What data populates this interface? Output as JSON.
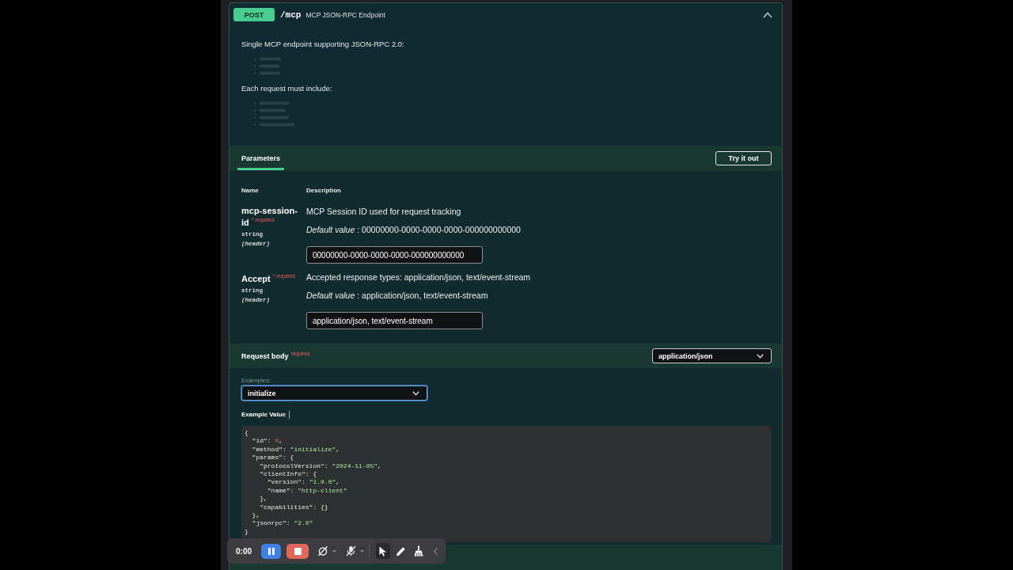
{
  "operation": {
    "method": "POST",
    "path": "/mcp",
    "summary": "MCP JSON-RPC Endpoint",
    "expanded": true
  },
  "description": [
    {
      "kind": "paragraph",
      "text": "Single MCP endpoint supporting JSON-RPC 2.0:"
    },
    {
      "kind": "faded_list"
    },
    {
      "kind": "paragraph",
      "text": "Each request must include:"
    },
    {
      "kind": "faded_list"
    }
  ],
  "parameters": {
    "tabs": [
      {
        "label": "Parameters",
        "selected": true
      }
    ],
    "try_button": "Try it out",
    "columns": [
      "Name",
      "Description"
    ],
    "rows": [
      {
        "name": "mcp-session-id",
        "required_label": "* required",
        "type": "string",
        "location": "(header)",
        "description": "MCP Session ID used for request tracking",
        "default": "*Default value* : 00000000-0000-0000-0000-000000000000",
        "value": "00000000-0000-0000-0000-000000000000"
      },
      {
        "name": "Accept",
        "required_label": "* required",
        "type": "string",
        "location": "(header)",
        "description": "Accepted response types: application/json, text/event-stream",
        "default": "*Default value* : application/json, text/event-stream",
        "value": "application/json, text/event-stream"
      }
    ]
  },
  "request_body": {
    "title": "Request body",
    "required_label": "required",
    "content_type": "application/json",
    "examples_label": "Examples:",
    "example": {
      "value": "initialize",
      "focused": true
    },
    "example_tabs": [
      {
        "label": "Example Value",
        "selected": true
      }
    ],
    "code": [
      [
        {
          "kind": "plain",
          "text": "{"
        }
      ],
      [
        {
          "kind": "plain",
          "text": "  \"id\": "
        },
        {
          "kind": "number",
          "text": "0"
        },
        {
          "kind": "plain",
          "text": ","
        }
      ],
      [
        {
          "kind": "plain",
          "text": "  \"method\": "
        },
        {
          "kind": "string",
          "text": "\"initialize\""
        },
        {
          "kind": "plain",
          "text": ","
        }
      ],
      [
        {
          "kind": "plain",
          "text": "  \"params\": {"
        }
      ],
      [
        {
          "kind": "plain",
          "text": "    \"protocolVersion\": "
        },
        {
          "kind": "string",
          "text": "\"2024-11-05\""
        },
        {
          "kind": "plain",
          "text": ","
        }
      ],
      [
        {
          "kind": "plain",
          "text": "    \"clientInfo\": {"
        }
      ],
      [
        {
          "kind": "plain",
          "text": "      \"version\": "
        },
        {
          "kind": "string",
          "text": "\"1.0.0\""
        },
        {
          "kind": "plain",
          "text": ","
        }
      ],
      [
        {
          "kind": "plain",
          "text": "      \"name\": "
        },
        {
          "kind": "string",
          "text": "\"http-client\""
        }
      ],
      [
        {
          "kind": "plain",
          "text": "    },"
        }
      ],
      [
        {
          "kind": "plain",
          "text": "    \"capabilities\": {}"
        }
      ],
      [
        {
          "kind": "plain",
          "text": "  },"
        }
      ],
      [
        {
          "kind": "plain",
          "text": "  \"jsonrpc\": "
        },
        {
          "kind": "string",
          "text": "\"2.0\""
        }
      ],
      [
        {
          "kind": "plain",
          "text": "}"
        }
      ]
    ]
  },
  "recorder": {
    "time": "0:00"
  }
}
